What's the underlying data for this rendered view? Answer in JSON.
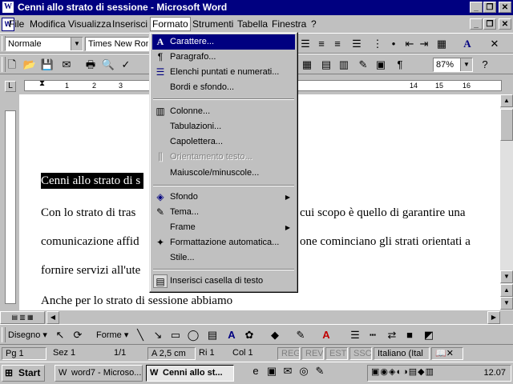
{
  "window": {
    "title": "Cenni allo strato di sessione - Microsoft Word",
    "app_icon": "W"
  },
  "menubar": {
    "items": [
      "File",
      "Modifica",
      "Visualizza",
      "Inserisci",
      "Formato",
      "Strumenti",
      "Tabella",
      "Finestra",
      "?"
    ],
    "active": "Formato"
  },
  "formatting_toolbar": {
    "style": "Normale",
    "font": "Times New Rom"
  },
  "standard_toolbar": {
    "zoom": "87%"
  },
  "ruler": {
    "numbers": [
      "1",
      "2",
      "3",
      "14",
      "15",
      "16"
    ]
  },
  "document": {
    "lines": [
      "Cenni allo strato di s",
      "Con lo strato di tras",
      "cui scopo è quello di garantire una",
      "comunicazione affid",
      "one cominciano gli strati orientati a",
      "fornire servizi all'ute",
      "Anche per lo strato di sessione abbiamo"
    ]
  },
  "format_menu": {
    "items": [
      {
        "label": "Carattere...",
        "icon": "font-icon",
        "selected": true
      },
      {
        "label": "Paragrafo...",
        "icon": "paragraph-icon"
      },
      {
        "label": "Elenchi puntati e numerati...",
        "icon": "bullets-icon"
      },
      {
        "label": "Bordi e sfondo...",
        "icon": ""
      },
      {
        "label": "Colonne...",
        "icon": "columns-icon"
      },
      {
        "label": "Tabulazioni...",
        "icon": ""
      },
      {
        "label": "Capolettera...",
        "icon": ""
      },
      {
        "label": "Orientamento testo...",
        "icon": "text-direction-icon",
        "disabled": true
      },
      {
        "label": "Maiuscole/minuscole...",
        "icon": ""
      },
      {
        "label": "Sfondo",
        "icon": "background-icon",
        "submenu": true
      },
      {
        "label": "Tema...",
        "icon": "theme-icon"
      },
      {
        "label": "Frame",
        "icon": "",
        "submenu": true
      },
      {
        "label": "Formattazione automatica...",
        "icon": "autoformat-icon"
      },
      {
        "label": "Stile...",
        "icon": ""
      },
      {
        "label": "Inserisci casella di testo",
        "icon": "textbox-icon",
        "pressed": true
      }
    ]
  },
  "drawing_toolbar": {
    "draw_label": "Disegno",
    "shapes_label": "Forme"
  },
  "statusbar": {
    "page": "Pg 1",
    "section": "Sez 1",
    "pages": "1/1",
    "position": "A 2,5 cm",
    "line": "Ri 1",
    "column": "Col 1",
    "rec": "REG",
    "rev": "REV",
    "ext": "EST",
    "ovr": "SSC",
    "language": "Italiano (Ital"
  },
  "taskbar": {
    "start": "Start",
    "tasks": [
      "word7 - Microso...",
      "Cenni allo st..."
    ],
    "clock": "12.07"
  }
}
